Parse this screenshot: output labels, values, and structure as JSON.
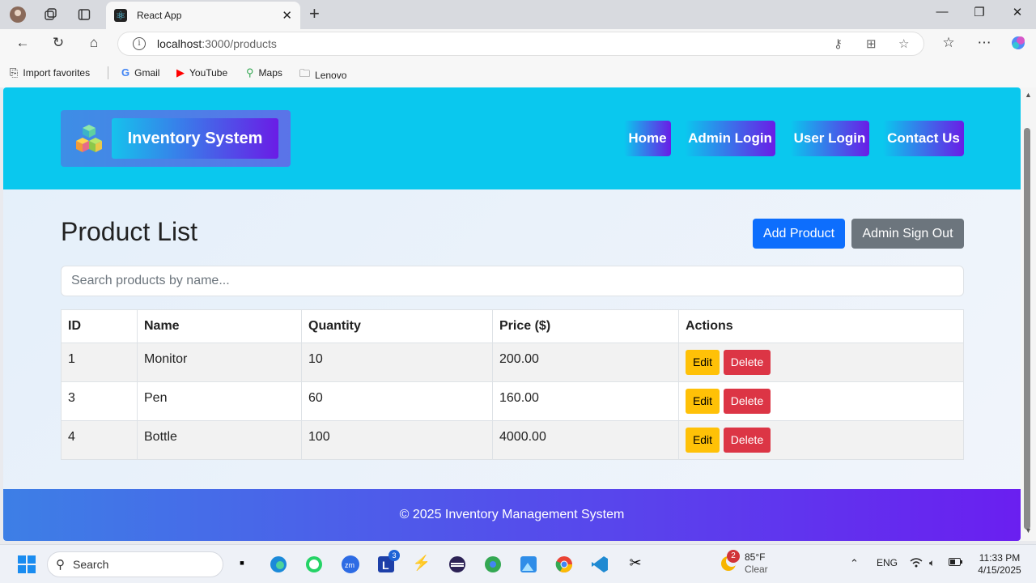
{
  "browser": {
    "tab_title": "React App",
    "url_host": "localhost",
    "url_path": ":3000/products",
    "favorites": [
      "Import favorites",
      "Gmail",
      "YouTube",
      "Maps",
      "Lenovo"
    ]
  },
  "header": {
    "brand": "Inventory System",
    "nav": [
      "Home",
      "Admin Login",
      "User Login",
      "Contact Us"
    ]
  },
  "main": {
    "title": "Product List",
    "add_button": "Add Product",
    "signout_button": "Admin Sign Out",
    "search_placeholder": "Search products by name...",
    "columns": [
      "ID",
      "Name",
      "Quantity",
      "Price ($)",
      "Actions"
    ],
    "rows": [
      {
        "id": "1",
        "name": "Monitor",
        "quantity": "10",
        "price": "200.00"
      },
      {
        "id": "3",
        "name": "Pen",
        "quantity": "60",
        "price": "160.00"
      },
      {
        "id": "4",
        "name": "Bottle",
        "quantity": "100",
        "price": "4000.00"
      }
    ],
    "edit_label": "Edit",
    "delete_label": "Delete"
  },
  "footer": {
    "text": "© 2025 Inventory Management System"
  },
  "taskbar": {
    "search_label": "Search",
    "weather_badge": "2",
    "weather_temp": "85°F",
    "weather_cond": "Clear",
    "lang": "ENG",
    "time": "11:33 PM",
    "date": "4/15/2025",
    "app_badge": "3"
  },
  "colors": {
    "header_bg": "#0ac8ee",
    "primary": "#0d6efd",
    "secondary": "#6c757d",
    "edit": "#ffc107",
    "delete": "#dc3545"
  }
}
